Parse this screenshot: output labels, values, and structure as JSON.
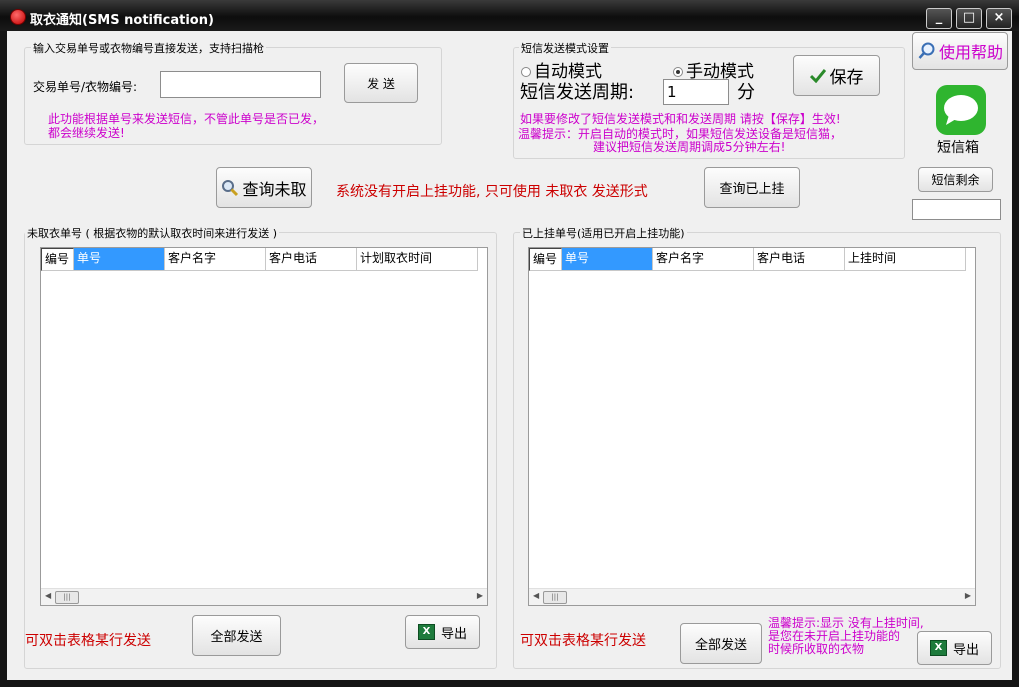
{
  "window": {
    "title": "取衣通知(SMS notification)",
    "minimize_glyph": "_",
    "maximize_glyph": "□",
    "close_glyph": "×"
  },
  "direct_send": {
    "group_label": "输入交易单号或衣物编号直接发送，支持扫描枪",
    "field_label": "交易单号/衣物编号:",
    "field_value": "",
    "send_label": "发 送",
    "note_line1": "此功能根据单号来发送短信，不管此单号是否已发，",
    "note_line2": "都会继续发送!"
  },
  "sms_mode": {
    "group_label": "短信发送模式设置",
    "auto_label": "自动模式",
    "manual_label": "手动模式",
    "selected": "manual",
    "period_label": "短信发送周期:",
    "period_value": "1",
    "period_unit": "分",
    "save_label": "保存",
    "note_line1": "如果要修改了短信发送模式和和发送周期 请按【保存】生效!",
    "note_line2": "温馨提示：开启自动的模式时，如果短信发送设备是短信猫，",
    "note_line3": "建议把短信发送周期调成5分钟左右!"
  },
  "help_label": "使用帮助",
  "inbox_label": "短信箱",
  "sms_remaining_label": "短信剩余",
  "sms_remaining_value": "",
  "query_uncollected_label": "查询未取",
  "warning_text": "系统没有开启上挂功能, 只可使用 未取衣 发送形式",
  "query_hung_label": "查询已上挂",
  "left_panel": {
    "group_label": "未取衣单号 ( 根据衣物的默认取衣时间来进行发送 )",
    "columns": [
      "编号",
      "单号",
      "客户名字",
      "客户电话",
      "计划取衣时间"
    ],
    "rows": [],
    "dblclick_hint": "可双击表格某行发送",
    "send_all_label": "全部发送",
    "export_label": "导出"
  },
  "right_panel": {
    "group_label": "已上挂单号(适用已开启上挂功能)",
    "columns": [
      "编号",
      "单号",
      "客户名字",
      "客户电话",
      "上挂时间"
    ],
    "rows": [],
    "dblclick_hint": "可双击表格某行发送",
    "send_all_label": "全部发送",
    "tip_line1": "温馨提示:显示 没有上挂时间,",
    "tip_line2": "是您在未开启上挂功能的",
    "tip_line3": "时候所收取的衣物",
    "export_label": "导出"
  },
  "icons": {
    "app": "app-icon",
    "search": "search-icon",
    "check": "check-icon",
    "sms": "sms-bubble-icon",
    "excel": "excel-icon",
    "excel_glyph": "X"
  },
  "colors": {
    "magenta_note": "#cc00cc",
    "red_warning": "#cc0000",
    "selected_header": "#3399ff",
    "sms_green": "#2fb52f",
    "titlebar": "#111111"
  }
}
